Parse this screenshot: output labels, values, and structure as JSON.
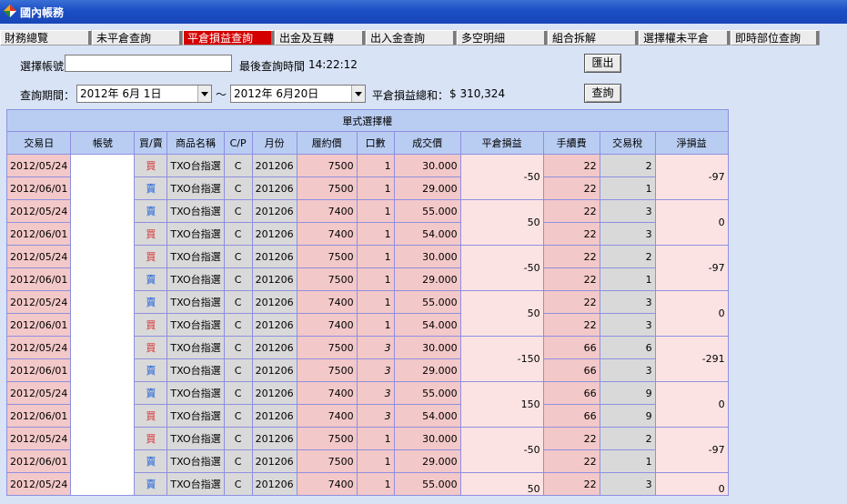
{
  "window": {
    "title": "國內帳務"
  },
  "tabs": [
    {
      "label": "財務總覽",
      "active": false
    },
    {
      "label": "未平倉查詢",
      "active": false
    },
    {
      "label": "平倉損益查詢",
      "active": true
    },
    {
      "label": "出金及互轉",
      "active": false
    },
    {
      "label": "出入金查詢",
      "active": false
    },
    {
      "label": "多空明細",
      "active": false
    },
    {
      "label": "組合拆解",
      "active": false
    },
    {
      "label": "選擇權未平倉",
      "active": false
    },
    {
      "label": "即時部位查詢",
      "active": false
    }
  ],
  "form": {
    "account_label": "選擇帳號",
    "last_query_label": "最後查詢時間",
    "last_query_time": "14:22:12",
    "export_button": "匯出",
    "period_label": "查詢期間：",
    "date_from": "2012年  6月 1日",
    "separator": "～",
    "date_to": "2012年  6月20日",
    "total_label": "平倉損益總和：",
    "total_value": "$ 310,324",
    "query_button": "查詢"
  },
  "table": {
    "group_header": "單式選擇權",
    "columns": [
      "交易日",
      "帳號",
      "買/賣",
      "商品名稱",
      "C/P",
      "月份",
      "履約價",
      "口數",
      "成交價",
      "平倉損益",
      "手續費",
      "交易稅",
      "淨損益"
    ],
    "groups": [
      {
        "pnl": "-50",
        "net": "-97",
        "rows": [
          {
            "date": "2012/05/24",
            "bs": "買",
            "side": "buy",
            "product": "TXO台指選",
            "cp": "C",
            "month": "201206",
            "strike": "7500",
            "qty": "1",
            "price": "30.000",
            "fee": "22",
            "tax": "2"
          },
          {
            "date": "2012/06/01",
            "bs": "賣",
            "side": "sell",
            "product": "TXO台指選",
            "cp": "C",
            "month": "201206",
            "strike": "7500",
            "qty": "1",
            "price": "29.000",
            "fee": "22",
            "tax": "1"
          }
        ]
      },
      {
        "pnl": "50",
        "net": "0",
        "rows": [
          {
            "date": "2012/05/24",
            "bs": "賣",
            "side": "sell",
            "product": "TXO台指選",
            "cp": "C",
            "month": "201206",
            "strike": "7400",
            "qty": "1",
            "price": "55.000",
            "fee": "22",
            "tax": "3"
          },
          {
            "date": "2012/06/01",
            "bs": "買",
            "side": "buy",
            "product": "TXO台指選",
            "cp": "C",
            "month": "201206",
            "strike": "7400",
            "qty": "1",
            "price": "54.000",
            "fee": "22",
            "tax": "3"
          }
        ]
      },
      {
        "pnl": "-50",
        "net": "-97",
        "rows": [
          {
            "date": "2012/05/24",
            "bs": "買",
            "side": "buy",
            "product": "TXO台指選",
            "cp": "C",
            "month": "201206",
            "strike": "7500",
            "qty": "1",
            "price": "30.000",
            "fee": "22",
            "tax": "2"
          },
          {
            "date": "2012/06/01",
            "bs": "賣",
            "side": "sell",
            "product": "TXO台指選",
            "cp": "C",
            "month": "201206",
            "strike": "7500",
            "qty": "1",
            "price": "29.000",
            "fee": "22",
            "tax": "1"
          }
        ]
      },
      {
        "pnl": "50",
        "net": "0",
        "rows": [
          {
            "date": "2012/05/24",
            "bs": "賣",
            "side": "sell",
            "product": "TXO台指選",
            "cp": "C",
            "month": "201206",
            "strike": "7400",
            "qty": "1",
            "price": "55.000",
            "fee": "22",
            "tax": "3"
          },
          {
            "date": "2012/06/01",
            "bs": "買",
            "side": "buy",
            "product": "TXO台指選",
            "cp": "C",
            "month": "201206",
            "strike": "7400",
            "qty": "1",
            "price": "54.000",
            "fee": "22",
            "tax": "3"
          }
        ]
      },
      {
        "pnl": "-150",
        "net": "-291",
        "rows": [
          {
            "date": "2012/05/24",
            "bs": "買",
            "side": "buy",
            "product": "TXO台指選",
            "cp": "C",
            "month": "201206",
            "strike": "7500",
            "qty": "3",
            "price": "30.000",
            "fee": "66",
            "tax": "6"
          },
          {
            "date": "2012/06/01",
            "bs": "賣",
            "side": "sell",
            "product": "TXO台指選",
            "cp": "C",
            "month": "201206",
            "strike": "7500",
            "qty": "3",
            "price": "29.000",
            "fee": "66",
            "tax": "3"
          }
        ]
      },
      {
        "pnl": "150",
        "net": "0",
        "rows": [
          {
            "date": "2012/05/24",
            "bs": "賣",
            "side": "sell",
            "product": "TXO台指選",
            "cp": "C",
            "month": "201206",
            "strike": "7400",
            "qty": "3",
            "price": "55.000",
            "fee": "66",
            "tax": "9"
          },
          {
            "date": "2012/06/01",
            "bs": "買",
            "side": "buy",
            "product": "TXO台指選",
            "cp": "C",
            "month": "201206",
            "strike": "7400",
            "qty": "3",
            "price": "54.000",
            "fee": "66",
            "tax": "9"
          }
        ]
      },
      {
        "pnl": "-50",
        "net": "-97",
        "rows": [
          {
            "date": "2012/05/24",
            "bs": "買",
            "side": "buy",
            "product": "TXO台指選",
            "cp": "C",
            "month": "201206",
            "strike": "7500",
            "qty": "1",
            "price": "30.000",
            "fee": "22",
            "tax": "2"
          },
          {
            "date": "2012/06/01",
            "bs": "賣",
            "side": "sell",
            "product": "TXO台指選",
            "cp": "C",
            "month": "201206",
            "strike": "7500",
            "qty": "1",
            "price": "29.000",
            "fee": "22",
            "tax": "1"
          }
        ]
      },
      {
        "pnl": "50",
        "net": "0",
        "rows": [
          {
            "date": "2012/05/24",
            "bs": "賣",
            "side": "sell",
            "product": "TXO台指選",
            "cp": "C",
            "month": "201206",
            "strike": "7400",
            "qty": "1",
            "price": "55.000",
            "fee": "22",
            "tax": "3"
          }
        ]
      }
    ]
  },
  "colors": {
    "title_bar": "#1b4fc4",
    "active_tab": "#d40000",
    "header": "#b9cdf2",
    "cell_pink": "#f3c8c8",
    "cell_gray": "#d9d9d9",
    "buy": "#d83030",
    "sell": "#1d5fd8",
    "grid_line": "#8f8fe0"
  },
  "icons": {
    "app": "app-logo-icon",
    "dropdown": "chevron-down-icon"
  }
}
